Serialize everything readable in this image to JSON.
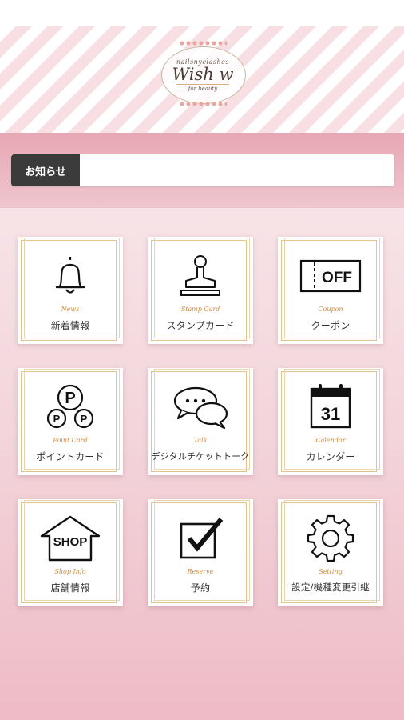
{
  "logo": {
    "sub": "nailsnyelashes",
    "main": "Wish w",
    "foot": "for beauty"
  },
  "news": {
    "label": "お知らせ"
  },
  "menu": [
    {
      "en": "News",
      "ja": "新着情報",
      "icon": "bell-icon"
    },
    {
      "en": "Stamp Card",
      "ja": "スタンプカード",
      "icon": "stamp-icon"
    },
    {
      "en": "Coupon",
      "ja": "クーポン",
      "icon": "coupon-icon",
      "icon_text": "OFF"
    },
    {
      "en": "Point Card",
      "ja": "ポイントカード",
      "icon": "points-icon",
      "icon_text": "P"
    },
    {
      "en": "Talk",
      "ja": "デジタルチケットトーク",
      "icon": "chat-icon"
    },
    {
      "en": "Calendar",
      "ja": "カレンダー",
      "icon": "calendar-icon",
      "icon_text": "31"
    },
    {
      "en": "Shop Info",
      "ja": "店舗情報",
      "icon": "shop-icon",
      "icon_text": "SHOP"
    },
    {
      "en": "Reserve",
      "ja": "予約",
      "icon": "checkbox-icon"
    },
    {
      "en": "Setting",
      "ja": "設定/機種変更引継",
      "icon": "gear-icon"
    }
  ],
  "colors": {
    "accent_gold": "#d38a3a",
    "label_dark": "#3b3b3b",
    "stripe_pink": "#f8dfe4"
  }
}
